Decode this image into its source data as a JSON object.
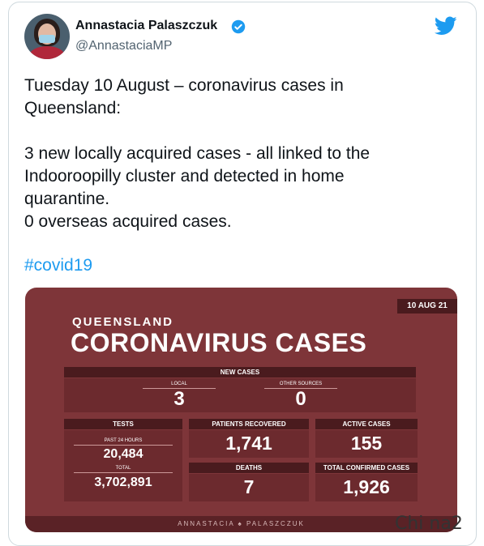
{
  "tweet": {
    "author_name": "Annastacia Palaszczuk",
    "author_handle": "@AnnastaciaMP",
    "text": "Tuesday 10 August – coronavirus cases in\nQueensland:\n\n3 new locally acquired cases - all linked to the\nIndooroopilly cluster and detected in home\nquarantine.\n0 overseas acquired cases.",
    "hashtag": "#covid19",
    "icons": [
      "verified-badge-icon",
      "twitter-bird-icon"
    ],
    "colors": {
      "link": "#1d9bf0",
      "graphic_bg": "#7e3539"
    }
  },
  "graphic": {
    "date": "10 AUG 21",
    "subtitle": "QUEENSLAND",
    "title": "CORONAVIRUS CASES",
    "new_cases": {
      "header": "NEW CASES",
      "local_label": "LOCAL",
      "local_value": "3",
      "other_label": "OTHER SOURCES",
      "other_value": "0"
    },
    "tests": {
      "header": "TESTS",
      "past24_label": "PAST 24 HOURS",
      "past24_value": "20,484",
      "total_label": "TOTAL",
      "total_value": "3,702,891"
    },
    "recovered": {
      "header": "PATIENTS RECOVERED",
      "value": "1,741"
    },
    "active": {
      "header": "ACTIVE CASES",
      "value": "155"
    },
    "deaths": {
      "header": "DEATHS",
      "value": "7"
    },
    "confirmed": {
      "header": "TOTAL CONFIRMED CASES",
      "value": "1,926"
    },
    "footer": "ANNASTACIA ♠ PALASZCZUK"
  },
  "watermark": "Chi na2"
}
